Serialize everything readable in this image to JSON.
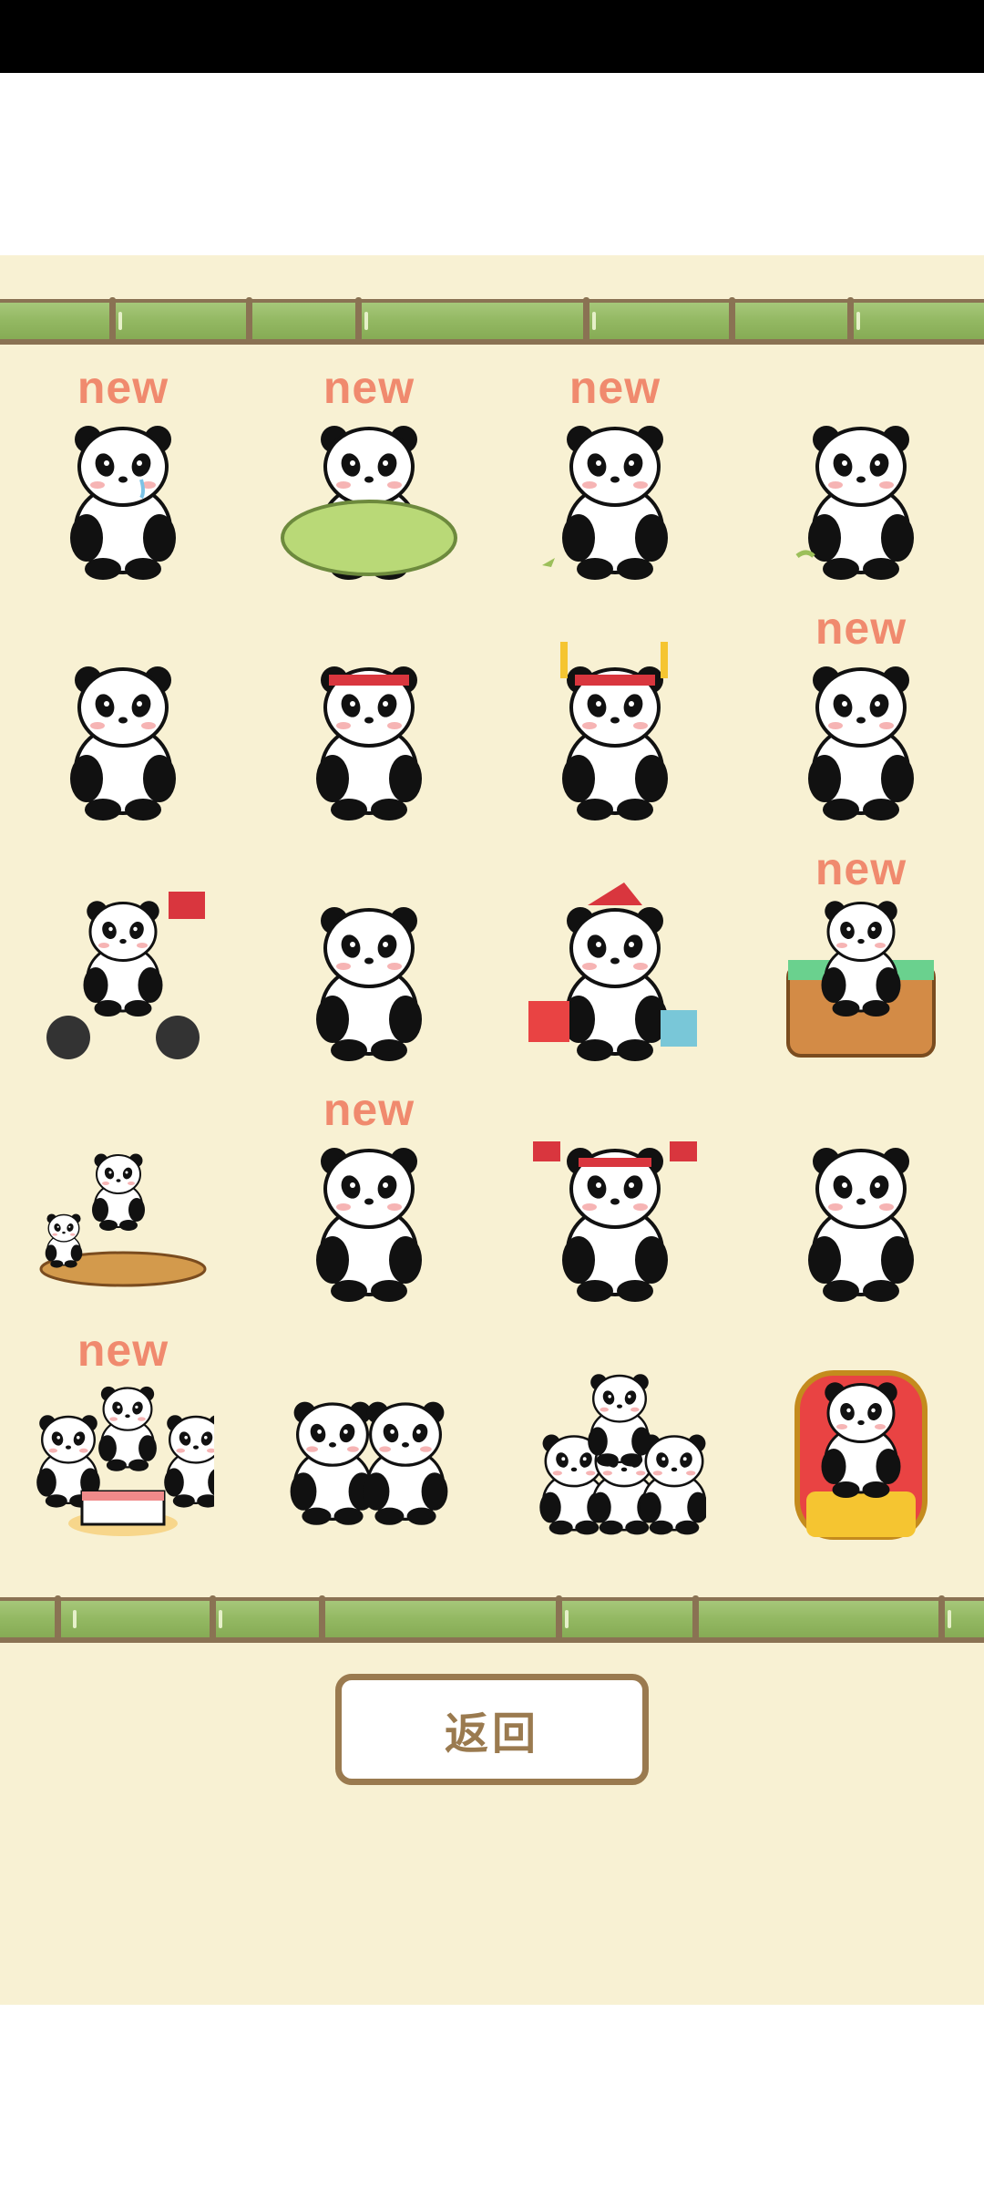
{
  "new_badge": "new",
  "back_button": "返回",
  "colors": {
    "background": "#f8f1d3",
    "bamboo": "#93b862",
    "bamboo_border": "#8a7253",
    "new_label": "#f08a6e",
    "button_border": "#9a7a4f"
  },
  "stickers": [
    {
      "id": "panda-crying",
      "new": true
    },
    {
      "id": "panda-sleeping-blanket",
      "new": true
    },
    {
      "id": "panda-waving-bird",
      "new": true
    },
    {
      "id": "panda-lying-eating",
      "new": false
    },
    {
      "id": "panda-shy",
      "new": false
    },
    {
      "id": "panda-headband-fishing",
      "new": false
    },
    {
      "id": "panda-cheering-glowsticks",
      "new": false
    },
    {
      "id": "panda-lying-pose",
      "new": true
    },
    {
      "id": "panda-motorcycle-flag",
      "new": false
    },
    {
      "id": "panda-blushing",
      "new": false
    },
    {
      "id": "panda-christmas-gifts",
      "new": false
    },
    {
      "id": "panda-bathtub",
      "new": true
    },
    {
      "id": "panda-tea-table",
      "new": false
    },
    {
      "id": "panda-thinking",
      "new": true
    },
    {
      "id": "panda-cheerleader-flags",
      "new": false
    },
    {
      "id": "panda-waving",
      "new": false
    },
    {
      "id": "panda-birthday-cake",
      "new": true
    },
    {
      "id": "panda-couple-hug",
      "new": false
    },
    {
      "id": "panda-stack",
      "new": false
    },
    {
      "id": "panda-king-throne",
      "new": false
    }
  ]
}
